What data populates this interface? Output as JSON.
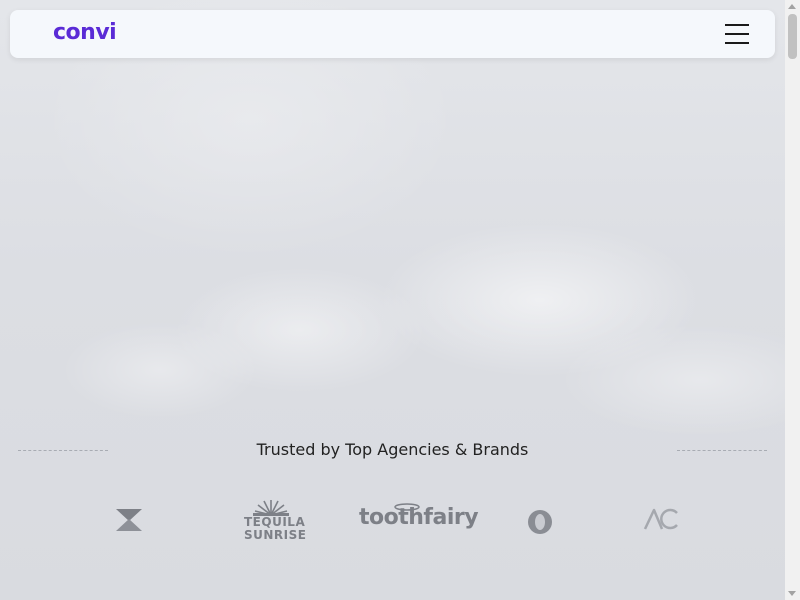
{
  "nav": {
    "logo": "convi",
    "menu_icon": "hamburger-icon"
  },
  "trusted": {
    "heading": "Trusted by Top Agencies & Brands"
  },
  "brands": [
    {
      "name": "brand-mark",
      "icon": "chevron-triangle-logo"
    },
    {
      "name": "Tequila Sunrise",
      "line1": "TEQUILA",
      "line2": "SUNRISE",
      "icon": "sun-rays-logo"
    },
    {
      "name": "toothfairy",
      "text": "toothfairy",
      "icon": "halo-logo"
    },
    {
      "name": "ring-logo",
      "icon": "circle-ring-logo"
    },
    {
      "name": "AC",
      "text": "AC"
    }
  ],
  "colors": {
    "brand_purple": "#5a2bd6",
    "logo_gray": "#7d8087",
    "text": "#222222"
  }
}
